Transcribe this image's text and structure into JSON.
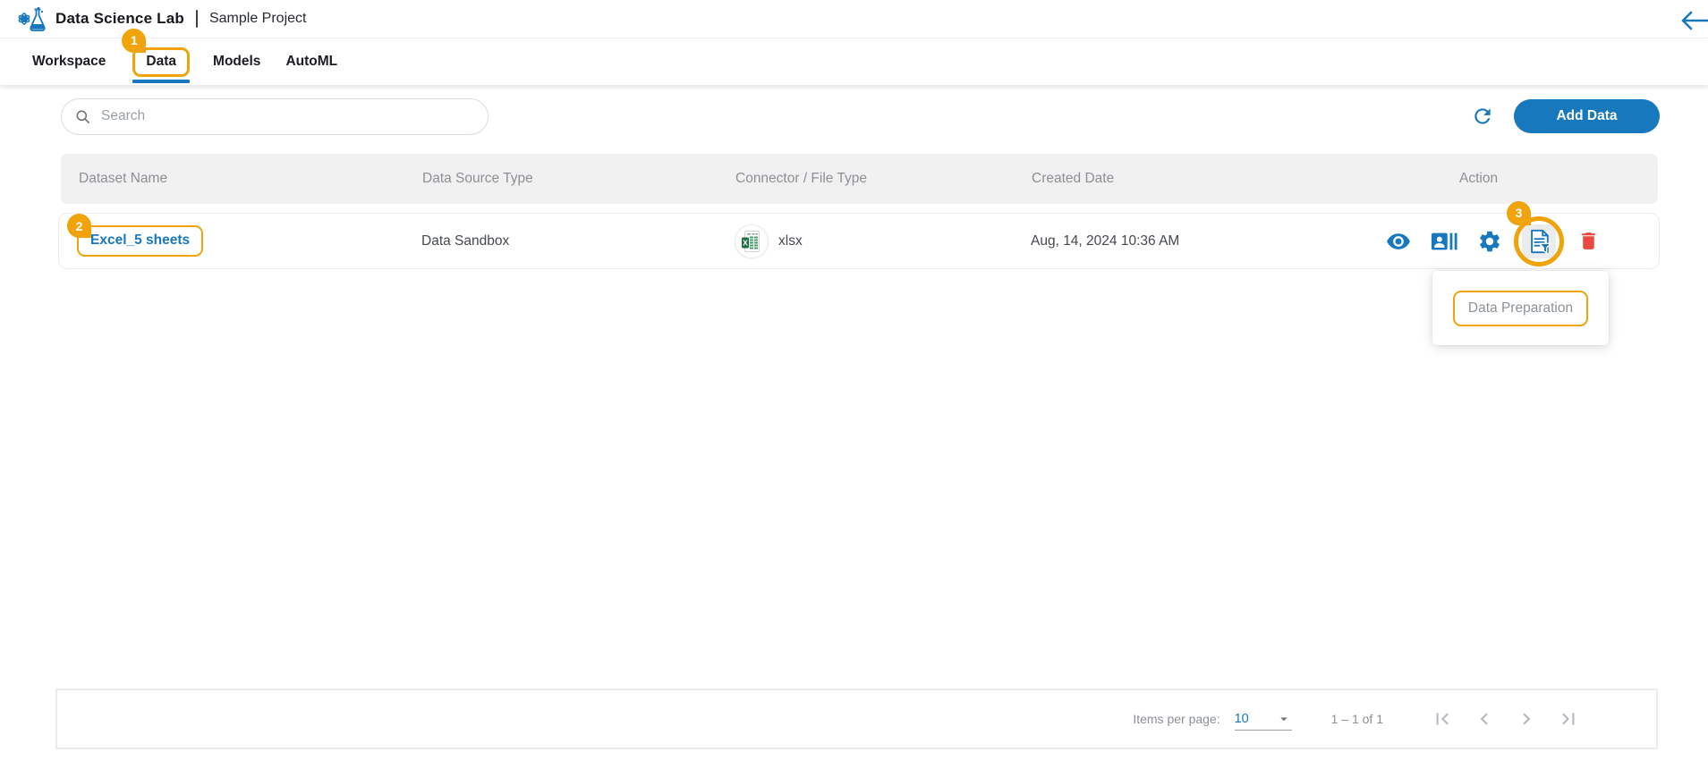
{
  "header": {
    "app_title": "Data Science Lab",
    "project_name": "Sample Project"
  },
  "nav": {
    "tabs": [
      {
        "label": "Workspace",
        "active": false
      },
      {
        "label": "Data",
        "active": true
      },
      {
        "label": "Models",
        "active": false
      },
      {
        "label": "AutoML",
        "active": false
      }
    ]
  },
  "annotations": {
    "step1": "1",
    "step2": "2",
    "step3": "3"
  },
  "toolbar": {
    "search_placeholder": "Search",
    "add_button_label": "Add Data"
  },
  "table": {
    "columns": [
      "Dataset Name",
      "Data Source Type",
      "Connector / File Type",
      "Created Date",
      "Action"
    ],
    "rows": [
      {
        "dataset_name": "Excel_5 sheets",
        "data_source_type": "Data Sandbox",
        "file_type": "xlsx",
        "created_date": "Aug, 14, 2024 10:36 AM",
        "actions": [
          "view",
          "dataset-details",
          "settings",
          "data-preparation",
          "delete"
        ]
      }
    ]
  },
  "tooltip": {
    "label": "Data Preparation"
  },
  "paginator": {
    "items_per_page_label": "Items per page:",
    "items_per_page_value": "10",
    "range_label": "1 – 1 of 1"
  },
  "colors": {
    "accent_orange": "#F0A30B",
    "primary_blue": "#1778BE",
    "delete_red": "#E84A3F",
    "excel_green": "#1E7145"
  }
}
